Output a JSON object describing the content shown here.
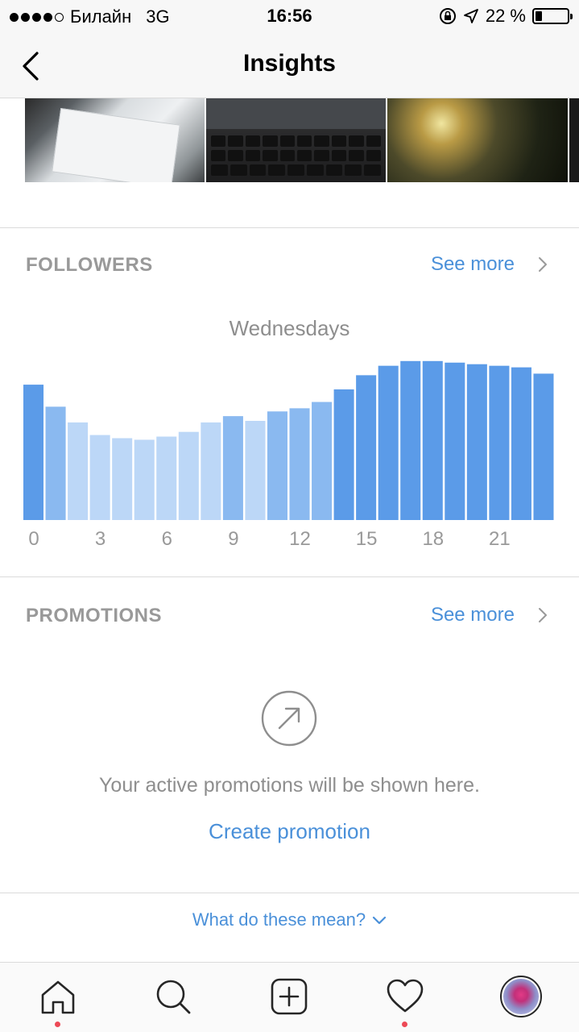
{
  "status_bar": {
    "carrier": "Билайн",
    "network": "3G",
    "time": "16:56",
    "battery_percent": "22 %",
    "battery_level": 0.22
  },
  "nav": {
    "title": "Insights",
    "back_icon": "chevron-left-icon"
  },
  "followers": {
    "header": "FOLLOWERS",
    "see_more": "See more"
  },
  "chart_data": {
    "type": "bar",
    "title": "Wednesdays",
    "xlabel": "",
    "ylabel": "",
    "categories": [
      "0",
      "1",
      "2",
      "3",
      "4",
      "5",
      "6",
      "7",
      "8",
      "9",
      "10",
      "11",
      "12",
      "13",
      "14",
      "15",
      "16",
      "17",
      "18",
      "19",
      "20",
      "21",
      "22",
      "23"
    ],
    "values": [
      86,
      72,
      62,
      54,
      52,
      51,
      53,
      56,
      62,
      66,
      63,
      69,
      71,
      75,
      83,
      92,
      98,
      101,
      101,
      100,
      99,
      98,
      97,
      93
    ],
    "x_tick_labels": [
      "0",
      "3",
      "6",
      "9",
      "12",
      "15",
      "18",
      "21"
    ],
    "ylim": [
      0,
      105
    ],
    "grid": false,
    "colors": {
      "low": "#bcd7f7",
      "mid": "#8ab9f0",
      "high": "#5b9be8"
    }
  },
  "promotions": {
    "header": "PROMOTIONS",
    "see_more": "See more",
    "empty_icon": "arrow-up-right-circle-icon",
    "empty_text": "Your active promotions will be shown here.",
    "create_link": "Create promotion"
  },
  "footer": {
    "what_mean": "What do these mean?"
  },
  "tab_bar": {
    "items": [
      "home-icon",
      "search-icon",
      "add-icon",
      "heart-icon",
      "profile-avatar"
    ]
  }
}
